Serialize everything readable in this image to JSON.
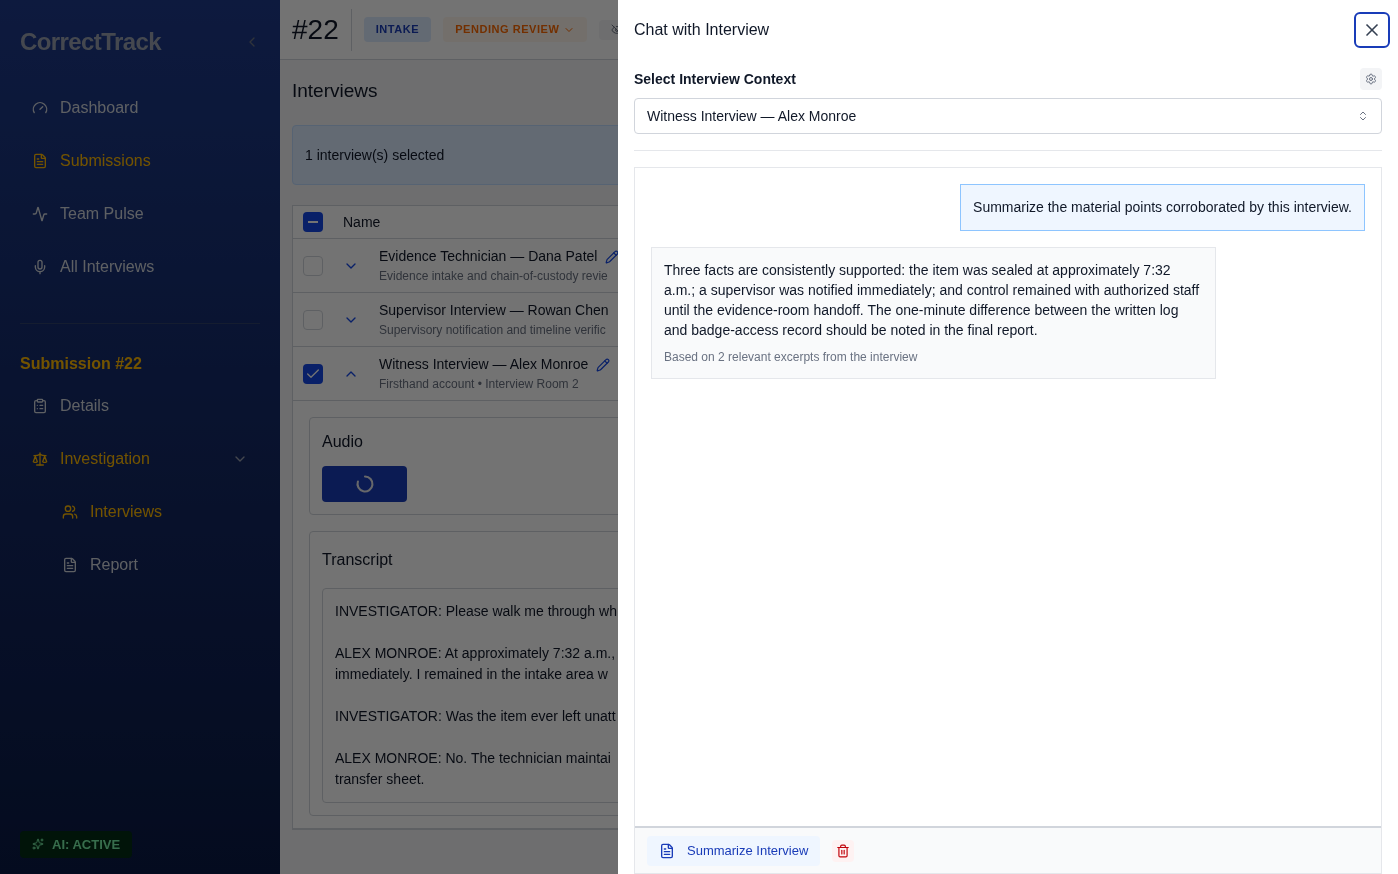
{
  "sidebar": {
    "logo": "CorrectTrack",
    "nav": [
      {
        "label": "Dashboard",
        "selected": false
      },
      {
        "label": "Submissions",
        "selected": true
      },
      {
        "label": "Team Pulse",
        "selected": false
      },
      {
        "label": "All Interviews",
        "selected": false
      }
    ],
    "section_title": "Submission #22",
    "section_items": [
      {
        "label": "Details",
        "selected": false
      },
      {
        "label": "Investigation",
        "selected": true,
        "expanded": true,
        "children": [
          {
            "label": "Interviews",
            "selected": true
          },
          {
            "label": "Report",
            "selected": false
          }
        ]
      }
    ],
    "status_badge": "AI: ACTIVE"
  },
  "header": {
    "number": "#22",
    "badges": [
      {
        "kind": "plain",
        "label": "INTAKE"
      },
      {
        "kind": "dropdown",
        "label": "PENDING REVIEW"
      },
      {
        "kind": "icon"
      }
    ]
  },
  "page_title": "Interviews",
  "selection_bar": "1 interview(s) selected",
  "table": {
    "select_all": {
      "indeterminate": true
    },
    "columns": [
      "Name"
    ],
    "rows": [
      {
        "title": "Evidence Technician — Dana Patel",
        "subtitle": "Evidence intake and chain-of-custody revie",
        "checked": false,
        "expanded": false,
        "editable": true
      },
      {
        "title": "Supervisor Interview — Rowan Chen",
        "subtitle": "Supervisory notification and timeline verific",
        "checked": false,
        "expanded": false
      },
      {
        "title": "Witness Interview — Alex Monroe",
        "subtitle": "Firsthand account • Interview Room 2",
        "checked": true,
        "expanded": true,
        "editable": true
      }
    ]
  },
  "details": {
    "audio": {
      "title": "Audio",
      "loading": true
    },
    "transcript": {
      "title": "Transcript",
      "paragraphs": [
        [
          "INVESTIGATOR: Please walk me through wh"
        ],
        [
          "ALEX MONROE: At approximately 7:32 a.m.,",
          "immediately. I remained in the intake area w"
        ],
        [
          "INVESTIGATOR: Was the item ever left unatt"
        ],
        [
          "ALEX MONROE: No. The technician maintai",
          "transfer sheet."
        ]
      ]
    }
  },
  "drawer": {
    "title": "Chat with Interview",
    "context_label": "Select Interview Context",
    "context_value": "Witness Interview — Alex Monroe",
    "messages": [
      {
        "kind": "user",
        "text": "Summarize the material points corroborated by this interview."
      },
      {
        "kind": "assistant",
        "text": "Three facts are consistently supported: the item was sealed at approximately 7:32 a.m.; a supervisor was notified immediately; and control remained with authorized staff until the evidence-room handoff. The one-minute difference between the written log and badge-access record should be noted in the final report.",
        "note": "Based on 2 relevant excerpts from the interview"
      }
    ],
    "summarize_button": "Summarize Interview"
  }
}
